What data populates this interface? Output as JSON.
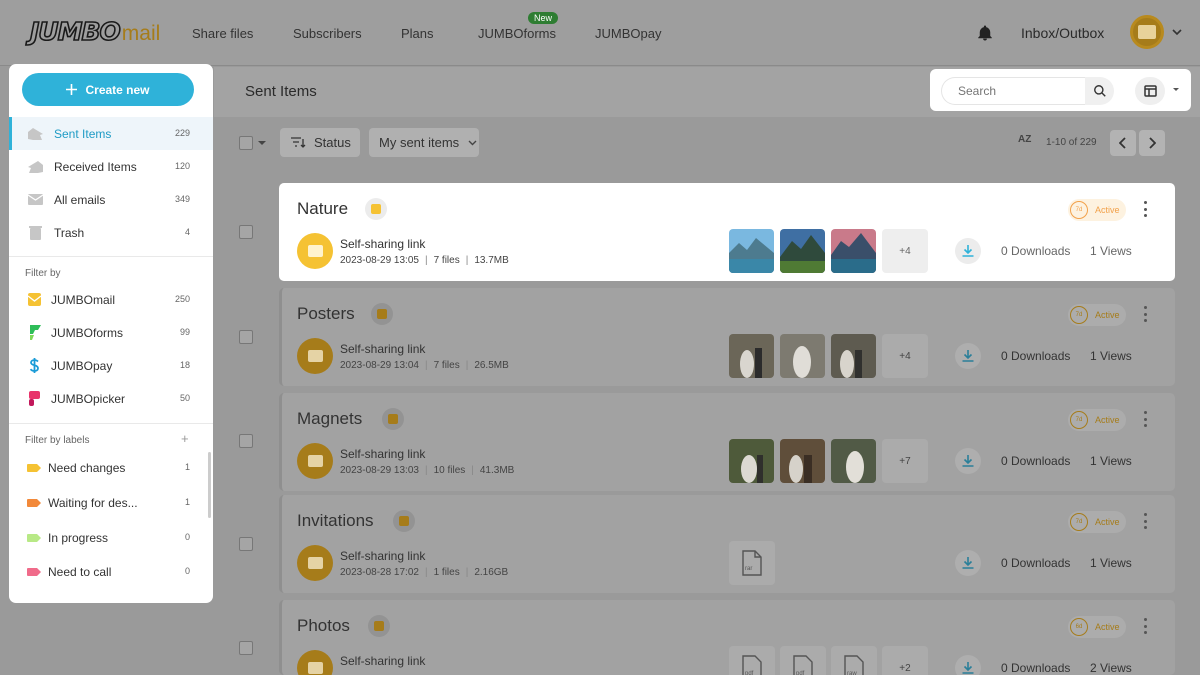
{
  "logo": {
    "main": "JUMBO",
    "sub": "mail"
  },
  "nav": {
    "links": [
      "Share files",
      "Subscribers",
      "Plans",
      "JUMBOforms",
      "JUMBOpay"
    ],
    "new_badge": "New",
    "inbox": "Inbox/Outbox"
  },
  "page": {
    "title": "Sent Items"
  },
  "search": {
    "placeholder": "Search"
  },
  "toolbar": {
    "status_label": "Status",
    "filter_label": "My sent items",
    "sort_icon": "AZ",
    "pager": "1-10 of 229"
  },
  "sidebar": {
    "create_label": "Create new",
    "folders": [
      {
        "label": "Sent Items",
        "count": "229",
        "icon": "sent-icon"
      },
      {
        "label": "Received Items",
        "count": "120",
        "icon": "received-icon"
      },
      {
        "label": "All emails",
        "count": "349",
        "icon": "envelope-icon"
      },
      {
        "label": "Trash",
        "count": "4",
        "icon": "trash-icon"
      }
    ],
    "filter_by": "Filter by",
    "apps": [
      {
        "label": "JUMBOmail",
        "count": "250",
        "color": "#f5c233"
      },
      {
        "label": "JUMBOforms",
        "count": "99",
        "color": "#2ebd59"
      },
      {
        "label": "JUMBOpay",
        "count": "18",
        "color": "#1a9bd7"
      },
      {
        "label": "JUMBOpicker",
        "count": "50",
        "color": "#e8336b"
      }
    ],
    "filter_by_labels": "Filter by labels",
    "add_label": "+",
    "labels": [
      {
        "label": "Need changes",
        "count": "1",
        "color": "#f5c233"
      },
      {
        "label": "Waiting for des...",
        "count": "1",
        "color": "#f2893a"
      },
      {
        "label": "In progress",
        "count": "0",
        "color": "#b8e986"
      },
      {
        "label": "Need to call",
        "count": "0",
        "color": "#f06b8a"
      }
    ]
  },
  "items": [
    {
      "title": "Nature",
      "link_type": "Self-sharing link",
      "date": "2023-08-29 13:05",
      "files": "7 files",
      "size": "13.7MB",
      "more": "+4",
      "downloads": "0 Downloads",
      "views": "1 Views",
      "status": "Active",
      "days": "7d"
    },
    {
      "title": "Posters",
      "link_type": "Self-sharing link",
      "date": "2023-08-29 13:04",
      "files": "7 files",
      "size": "26.5MB",
      "more": "+4",
      "downloads": "0 Downloads",
      "views": "1 Views",
      "status": "Active",
      "days": "7d"
    },
    {
      "title": "Magnets",
      "link_type": "Self-sharing link",
      "date": "2023-08-29 13:03",
      "files": "10 files",
      "size": "41.3MB",
      "more": "+7",
      "downloads": "0 Downloads",
      "views": "1 Views",
      "status": "Active",
      "days": "7d"
    },
    {
      "title": "Invitations",
      "link_type": "Self-sharing link",
      "date": "2023-08-28 17:02",
      "files": "1 files",
      "size": "2.16GB",
      "file_type": "rar",
      "downloads": "0 Downloads",
      "views": "1 Views",
      "status": "Active",
      "days": "7d"
    },
    {
      "title": "Photos",
      "link_type": "Self-sharing link",
      "file_types": [
        "pdf",
        "pdf",
        "raw"
      ],
      "more": "+2",
      "downloads": "0 Downloads",
      "views": "2 Views",
      "status": "Active",
      "days": "6d"
    }
  ],
  "colors": {
    "accent": "#2fb2d9",
    "brand": "#f5c233",
    "status": "#f2a14a"
  }
}
